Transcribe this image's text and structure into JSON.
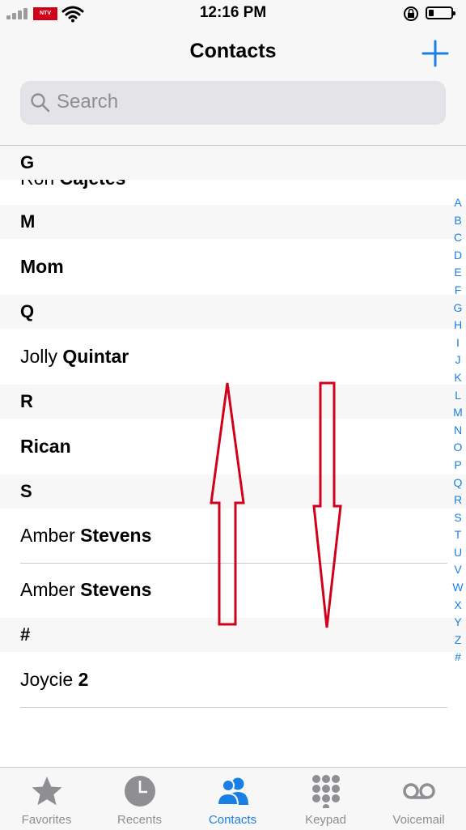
{
  "status_bar": {
    "time": "12:16 PM",
    "carrier_badge": "NTV"
  },
  "nav": {
    "title": "Contacts",
    "add_icon": "plus-icon"
  },
  "search": {
    "placeholder": "Search"
  },
  "sections": [
    {
      "letter": "G",
      "contacts": [
        {
          "first": "Ron ",
          "last": "Cajetes"
        }
      ]
    },
    {
      "letter": "M",
      "contacts": [
        {
          "first": "",
          "last": "Mom"
        }
      ]
    },
    {
      "letter": "Q",
      "contacts": [
        {
          "first": "Jolly ",
          "last": "Quintar"
        }
      ]
    },
    {
      "letter": "R",
      "contacts": [
        {
          "first": "",
          "last": "Rican"
        }
      ]
    },
    {
      "letter": "S",
      "contacts": [
        {
          "first": "Amber ",
          "last": "Stevens"
        },
        {
          "first": "Amber ",
          "last": "Stevens"
        }
      ]
    },
    {
      "letter": "#",
      "contacts": [
        {
          "first": "Joycie ",
          "last": "2"
        }
      ]
    }
  ],
  "index_letters": [
    "A",
    "B",
    "C",
    "D",
    "E",
    "F",
    "G",
    "H",
    "I",
    "J",
    "K",
    "L",
    "M",
    "N",
    "O",
    "P",
    "Q",
    "R",
    "S",
    "T",
    "U",
    "V",
    "W",
    "X",
    "Y",
    "Z",
    "#"
  ],
  "tabs": [
    {
      "label": "Favorites",
      "icon": "star-icon",
      "active": false
    },
    {
      "label": "Recents",
      "icon": "clock-icon",
      "active": false
    },
    {
      "label": "Contacts",
      "icon": "contacts-icon",
      "active": true
    },
    {
      "label": "Keypad",
      "icon": "keypad-icon",
      "active": false
    },
    {
      "label": "Voicemail",
      "icon": "voicemail-icon",
      "active": false
    }
  ],
  "colors": {
    "accent": "#1a7fe4",
    "annotation_arrow": "#d0021b",
    "inactive": "#8e8e93"
  }
}
